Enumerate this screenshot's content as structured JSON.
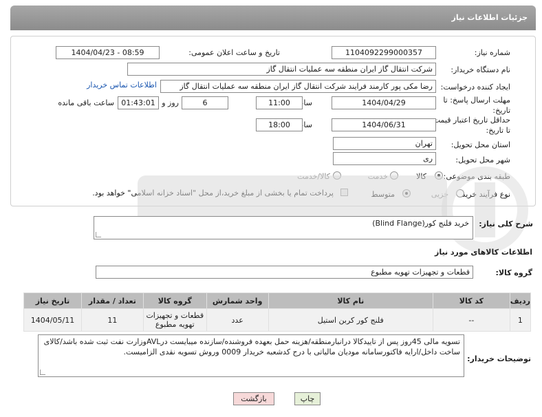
{
  "header": {
    "title": "جزئیات اطلاعات نیاز"
  },
  "form": {
    "need_number_label": "شماره نیاز:",
    "need_number": "1104092299000357",
    "announce_label": "تاریخ و ساعت اعلان عمومی:",
    "announce_value": "1404/04/23 - 08:59",
    "buyer_org_label": "نام دستگاه خریدار:",
    "buyer_org": "شرکت انتقال گاز ایران منطقه سه عملیات انتقال گاز",
    "requester_label": "ایجاد کننده درخواست:",
    "requester": "رضا مکی پور کارمند فرایند شرکت انتقال گاز ایران منطقه سه عملیات انتقال گاز",
    "contact_link": "اطلاعات تماس خریدار",
    "deadline_label_1": "مهلت ارسال پاسخ: تا",
    "deadline_label_2": "تاریخ:",
    "deadline_date": "1404/04/29",
    "time_label": "ساعت",
    "deadline_time": "11:00",
    "days_value": "6",
    "days_label": "روز و",
    "remaining_time": "01:43:01",
    "remaining_label": "ساعت باقی مانده",
    "validity_label_1": "حداقل تاریخ اعتبار قیمت:",
    "validity_label_2": "تا تاریخ:",
    "validity_date": "1404/06/31",
    "validity_time": "18:00",
    "province_label": "استان محل تحویل:",
    "province": "تهران",
    "city_label": "شهر محل تحویل:",
    "city": "ری",
    "category_label": "طبقه بندی موضوعی:",
    "category_options": [
      "کالا",
      "خدمت",
      "کالا/خدمت"
    ],
    "process_label": "نوع فرآیند خرید :",
    "process_options": [
      "جزیی",
      "متوسط"
    ],
    "payment_note": "پرداخت تمام یا بخشی از مبلغ خرید،از محل \"اسناد خزانه اسلامی\" خواهد بود."
  },
  "description": {
    "label": "شرح کلی نیاز:",
    "value": "خرید فلنج کور(Blind Flange)"
  },
  "goods": {
    "section_title": "اطلاعات کالاهای مورد نیاز",
    "group_label": "گروه کالا:",
    "group_value": "قطعات و تجهیزات تهویه مطبوع"
  },
  "table": {
    "headers": [
      "ردیف",
      "کد کالا",
      "نام کالا",
      "واحد شمارش",
      "گروه کالا",
      "تعداد / مقدار",
      "تاریخ نیاز"
    ],
    "rows": [
      [
        "1",
        "--",
        "فلنج کور کربن استیل",
        "عدد",
        "قطعات و تجهیزات تهویه مطبوع",
        "11",
        "1404/05/11"
      ]
    ]
  },
  "notes": {
    "label": "توضیحات خریدار:",
    "value": "تسویه مالی 45روز پس از تاییدکالا درانبارمنطقه/هزینه حمل بعهده فروشنده/سازنده میبایست درAVLوزارت نفت ثبت شده باشد/کالای ساخت داخل/ارایه فاکتورسامانه مودیان مالیاتی با درج کدشعبه خریدار 0009 وروش تسویه نقدی الزامیست."
  },
  "buttons": {
    "print": "چاپ",
    "back": "بازگشت"
  },
  "colors": {
    "header": "#999999",
    "link": "#1a56b0",
    "table_header": "#bdbdbd",
    "back_button": "#f7d9d9",
    "print_button": "#e6f0d8"
  }
}
